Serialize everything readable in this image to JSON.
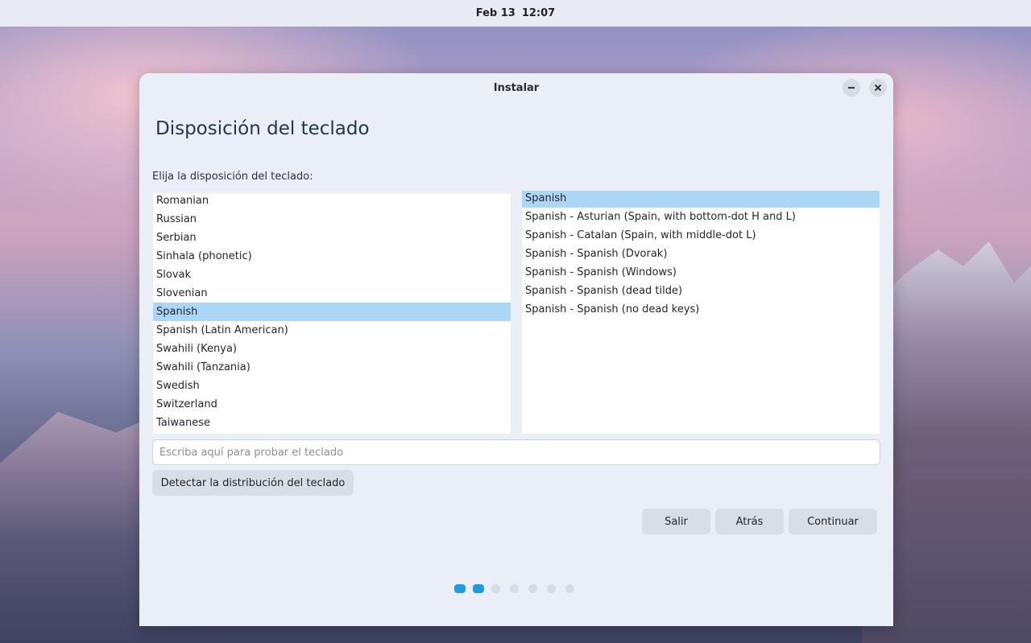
{
  "topbar": {
    "date": "Feb 13",
    "time": "12:07"
  },
  "window": {
    "title": "Instalar",
    "minimize_icon": "minimize-icon",
    "close_icon": "close-icon"
  },
  "page": {
    "heading": "Disposición del teclado",
    "prompt": "Elija la disposición del teclado:"
  },
  "layouts": {
    "items": [
      "Romanian",
      "Russian",
      "Serbian",
      "Sinhala (phonetic)",
      "Slovak",
      "Slovenian",
      "Spanish",
      "Spanish (Latin American)",
      "Swahili (Kenya)",
      "Swahili (Tanzania)",
      "Swedish",
      "Switzerland",
      "Taiwanese"
    ],
    "selected": "Spanish"
  },
  "variants": {
    "items": [
      "Spanish",
      "Spanish - Asturian (Spain, with bottom-dot H and L)",
      "Spanish - Catalan (Spain, with middle-dot L)",
      "Spanish - Spanish (Dvorak)",
      "Spanish - Spanish (Windows)",
      "Spanish - Spanish (dead tilde)",
      "Spanish - Spanish (no dead keys)"
    ],
    "selected": "Spanish"
  },
  "test_field": {
    "placeholder": "Escriba aquí para probar el teclado",
    "value": ""
  },
  "buttons": {
    "detect": "Detectar la distribución del teclado",
    "quit": "Salir",
    "back": "Atrás",
    "continue": "Continuar"
  },
  "pager": {
    "total": 7,
    "active": [
      0,
      1
    ]
  },
  "colors": {
    "accent": "#1e9be0",
    "selection": "#acd6f6",
    "window_bg": "#eaeef6"
  }
}
